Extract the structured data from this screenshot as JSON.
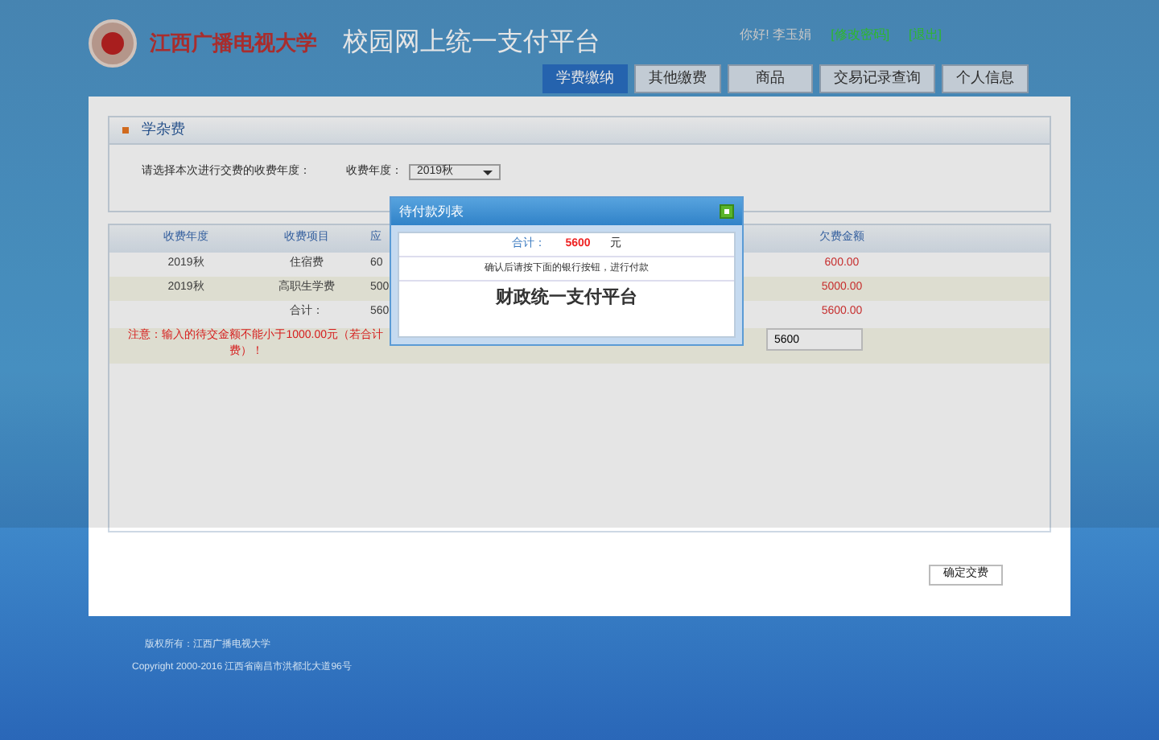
{
  "header": {
    "logo_text": "江西广播电视大学",
    "title": "校园网上统一支付平台",
    "greeting": "你好! 李玉娟",
    "links": [
      "[修改密码]",
      "[退出]"
    ]
  },
  "tabs": [
    {
      "label": "学费缴纳",
      "selected": true
    },
    {
      "label": "其他缴费",
      "selected": false
    },
    {
      "label": "商品",
      "selected": false
    },
    {
      "label": "交易记录查询",
      "selected": false
    },
    {
      "label": "个人信息",
      "selected": false
    }
  ],
  "section": {
    "title": "学杂费",
    "prompt": "请选择本次进行交费的收费年度：",
    "year_label": "收费年度：",
    "year_value": "2019秋"
  },
  "table": {
    "columns": [
      "收费年度",
      "收费项目",
      "应",
      "欠费金额"
    ],
    "rows": [
      [
        "2019秋",
        "住宿费",
        "60",
        "600.00"
      ],
      [
        "2019秋",
        "高职生学费",
        "500",
        "5000.00"
      ],
      [
        "",
        "合计：",
        "560",
        "5600.00"
      ]
    ]
  },
  "notice": [
    "注意：输入的待交金额不能小于1000.00元（若合计",
    "费）！"
  ],
  "amount_input": {
    "value": "5600"
  },
  "submit_button": "确定交费",
  "dialog": {
    "title": "待付款列表",
    "total_label": "合计：",
    "total_value": "5600",
    "unit": "元",
    "instruction": "确认后请按下面的银行按钮，进行付款",
    "bank_button": "财政统一支付平台"
  },
  "footer": [
    "版权所有：江西广播电视大学",
    "Copyright 2000-2016 江西省南昌市洪都北大道96号"
  ]
}
